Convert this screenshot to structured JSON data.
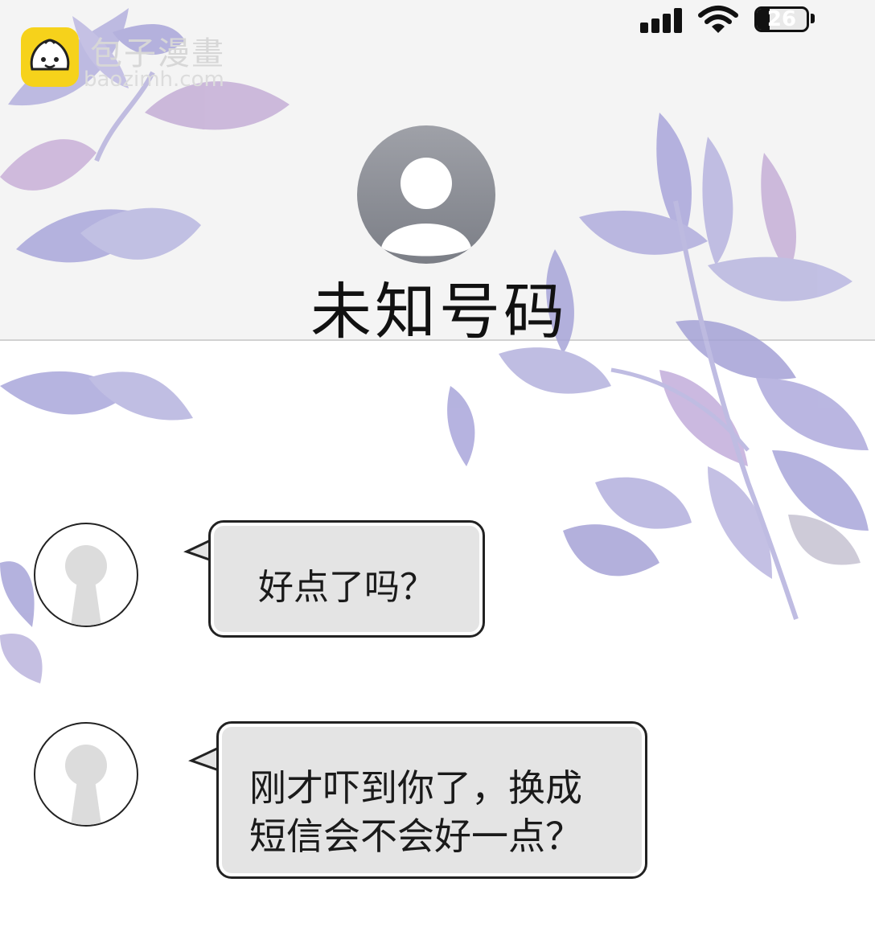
{
  "watermark": {
    "name": "包子漫畫",
    "url": "baozimh.com"
  },
  "status_bar": {
    "battery_level": "26",
    "battery_fill_percent": 26
  },
  "contact": {
    "name": "未知号码"
  },
  "messages": [
    {
      "text": "好点了吗？"
    },
    {
      "line1": "刚才吓到你了，换成",
      "line2": "短信会不会好一点？"
    }
  ],
  "colors": {
    "header_bg": "#f4f4f4",
    "bubble_bg": "#e4e4e4",
    "leaf_purple": "#a8a6d8",
    "leaf_pink": "#d7a9cf"
  }
}
